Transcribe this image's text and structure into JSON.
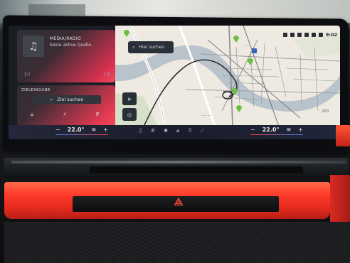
{
  "status": {
    "time": "9:02"
  },
  "map": {
    "search_label": "Hier suchen",
    "zoom": "200",
    "icons": [
      "pin-icon",
      "search-icon",
      "location-arrow-icon",
      "layers-icon"
    ]
  },
  "media": {
    "source": "MEDIA/RADIO",
    "status": "Keine aktive Quelle."
  },
  "destination": {
    "title": "ZIELEINGABE",
    "search_label": "Ziel suchen",
    "parking_label": "P"
  },
  "climate": {
    "left_temp": "22.0°",
    "right_temp": "22.0°",
    "minus": "−",
    "plus": "+"
  },
  "colors": {
    "accent_red": "#e23a52",
    "map_route": "#2b2d31",
    "pin_green": "#6cbf3c"
  }
}
